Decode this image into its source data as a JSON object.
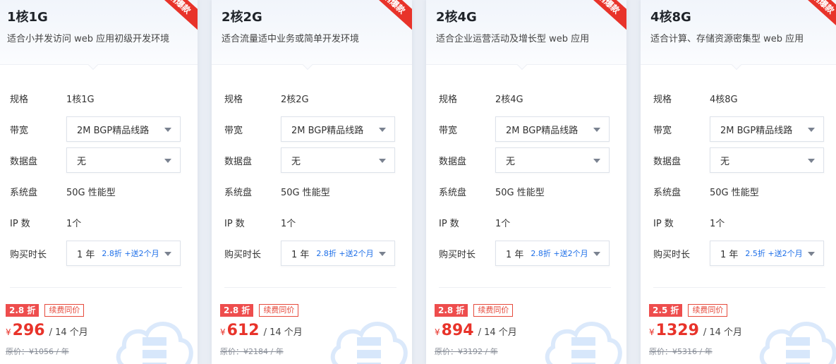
{
  "labels": {
    "spec": "规格",
    "bandwidth": "带宽",
    "disk": "数据盘",
    "system_disk": "系统盘",
    "ip": "IP 数",
    "duration": "购买时长",
    "renew": "续费同价"
  },
  "ribbon": "销爆款",
  "colors": {
    "accent": "#e8332a",
    "promo_blue": "#1c6ee8"
  },
  "cards": [
    {
      "title": "1核1G",
      "desc": "适合小并发访问 web 应用初级开发环境",
      "spec": "1核1G",
      "bandwidth": "2M BGP精品线路",
      "disk": "无",
      "system_disk": "50G 性能型",
      "ip": "1个",
      "duration": "1 年",
      "duration_promo": "2.8折 +送2个月",
      "discount": "2.8 折",
      "currency": "¥",
      "price": "296",
      "per": "/ 14 个月",
      "original": "原价：¥1056 / 年"
    },
    {
      "title": "2核2G",
      "desc": "适合流量适中业务或简单开发环境",
      "spec": "2核2G",
      "bandwidth": "2M BGP精品线路",
      "disk": "无",
      "system_disk": "50G 性能型",
      "ip": "1个",
      "duration": "1 年",
      "duration_promo": "2.8折 +送2个月",
      "discount": "2.8 折",
      "currency": "¥",
      "price": "612",
      "per": "/ 14 个月",
      "original": "原价：¥2184 / 年"
    },
    {
      "title": "2核4G",
      "desc": "适合企业运营活动及增长型 web 应用",
      "spec": "2核4G",
      "bandwidth": "2M BGP精品线路",
      "disk": "无",
      "system_disk": "50G 性能型",
      "ip": "1个",
      "duration": "1 年",
      "duration_promo": "2.8折 +送2个月",
      "discount": "2.8 折",
      "currency": "¥",
      "price": "894",
      "per": "/ 14 个月",
      "original": "原价：¥3192 / 年"
    },
    {
      "title": "4核8G",
      "desc": "适合计算、存储资源密集型 web 应用",
      "spec": "4核8G",
      "bandwidth": "2M BGP精品线路",
      "disk": "无",
      "system_disk": "50G 性能型",
      "ip": "1个",
      "duration": "1 年",
      "duration_promo": "2.5折 +送2个月",
      "discount": "2.5 折",
      "currency": "¥",
      "price": "1329",
      "per": "/ 14 个月",
      "original": "原价：¥5316 / 年"
    }
  ]
}
